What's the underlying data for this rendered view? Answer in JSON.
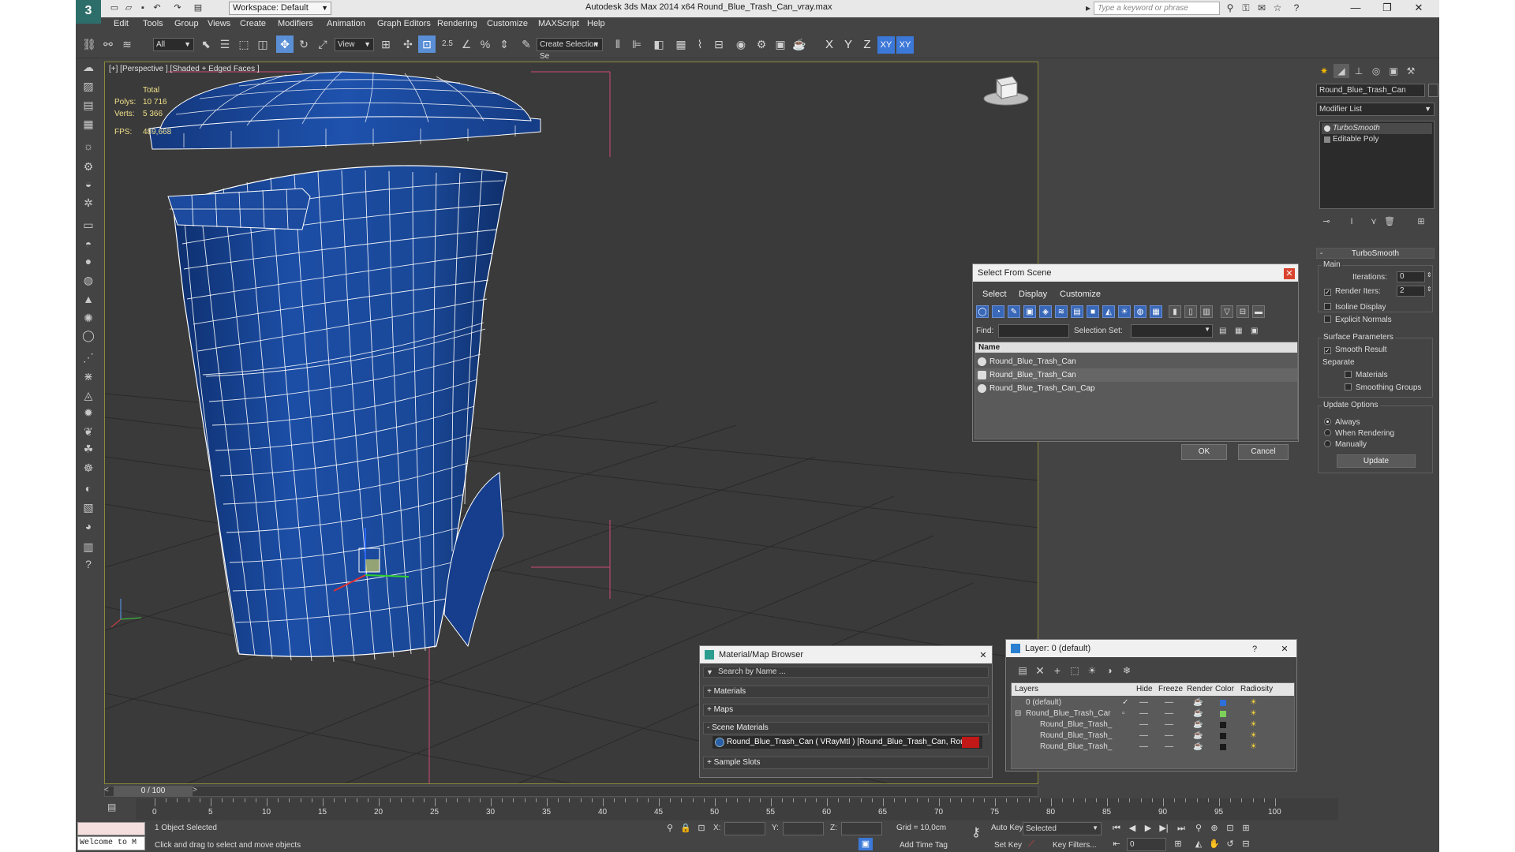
{
  "titlebar": {
    "workspace": "Workspace: Default",
    "title": "Autodesk 3ds Max  2014 x64     Round_Blue_Trash_Can_vray.max",
    "search_placeholder": "Type a keyword or phrase"
  },
  "menu": [
    "Edit",
    "Tools",
    "Group",
    "Views",
    "Create",
    "Modifiers",
    "Animation",
    "Graph Editors",
    "Rendering",
    "Customize",
    "MAXScript",
    "Help"
  ],
  "toolbar": {
    "selection_filter": "All",
    "ref_coord": "View",
    "snap_label": "2.5",
    "named_selection_placeholder": "Create Selection Se",
    "axis": [
      "X",
      "Y",
      "Z",
      "XY",
      "XY"
    ]
  },
  "viewport": {
    "label": "[+] [Perspective ] [Shaded + Edged Faces ]",
    "stats": {
      "total": "Total",
      "polys_label": "Polys:",
      "polys": "10 716",
      "verts_label": "Verts:",
      "verts": "5 366",
      "fps_label": "FPS:",
      "fps": "489,668"
    },
    "colors": {
      "mesh": "#1b4a9e",
      "wire": "#ffffff",
      "bg": "#3a3a3a"
    }
  },
  "command_panel": {
    "object_name": "Round_Blue_Trash_Can",
    "modifier_list": "Modifier List",
    "stack": [
      "TurboSmooth",
      "Editable Poly"
    ],
    "turbosmooth": {
      "title": "TurboSmooth",
      "main": "Main",
      "iterations_label": "Iterations:",
      "iterations": "0",
      "render_iters_label": "Render Iters:",
      "render_iters": "2",
      "isoline": "Isoline Display",
      "explicit_normals": "Explicit Normals",
      "surface_params": "Surface Parameters",
      "smooth_result": "Smooth Result",
      "separate": "Separate",
      "materials": "Materials",
      "smoothing_groups": "Smoothing Groups",
      "update_options": "Update Options",
      "always": "Always",
      "when_rendering": "When Rendering",
      "manually": "Manually",
      "update": "Update"
    }
  },
  "select_from_scene": {
    "title": "Select From Scene",
    "menu": [
      "Select",
      "Display",
      "Customize"
    ],
    "find_label": "Find:",
    "selection_set_label": "Selection Set:",
    "column": "Name",
    "rows": [
      "Round_Blue_Trash_Can",
      "Round_Blue_Trash_Can",
      "Round_Blue_Trash_Can_Cap"
    ],
    "ok": "OK",
    "cancel": "Cancel"
  },
  "material_browser": {
    "title": "Material/Map Browser",
    "search": "Search by Name ...",
    "sections": [
      "+ Materials",
      "+ Maps",
      "- Scene Materials",
      "+ Sample Slots"
    ],
    "scene_material": "Round_Blue_Trash_Can  ( VRayMtl )  [Round_Blue_Trash_Can, Rou..."
  },
  "layer_dialog": {
    "title": "Layer: 0 (default)",
    "columns": [
      "Layers",
      "Hide",
      "Freeze",
      "Render",
      "Color",
      "Radiosity"
    ],
    "rows": [
      {
        "name": "0 (default)",
        "color": "#2f6fd8"
      },
      {
        "name": "Round_Blue_Trash_Car",
        "color": "#7cd05a"
      },
      {
        "name": "Round_Blue_Trash_",
        "color": "#1a1a1a"
      },
      {
        "name": "Round_Blue_Trash_",
        "color": "#1a1a1a"
      },
      {
        "name": "Round_Blue_Trash_",
        "color": "#1a1a1a"
      }
    ]
  },
  "timeline": {
    "frame": "0 / 100",
    "ticks": [
      "0",
      "5",
      "10",
      "15",
      "20",
      "25",
      "30",
      "35",
      "40",
      "45",
      "50",
      "55",
      "60",
      "65",
      "70",
      "75",
      "80",
      "85",
      "90",
      "95",
      "100"
    ]
  },
  "status": {
    "maxscript": "Welcome to M",
    "selected": "1 Object Selected",
    "prompt": "Click and drag to select and move objects",
    "x_label": "X:",
    "y_label": "Y:",
    "z_label": "Z:",
    "grid": "Grid = 10,0cm",
    "add_time_tag": "Add Time Tag",
    "auto_key": "Auto Key",
    "set_key": "Set Key",
    "selected_dropdown": "Selected",
    "key_filters": "Key Filters...",
    "frame_field": "0"
  }
}
